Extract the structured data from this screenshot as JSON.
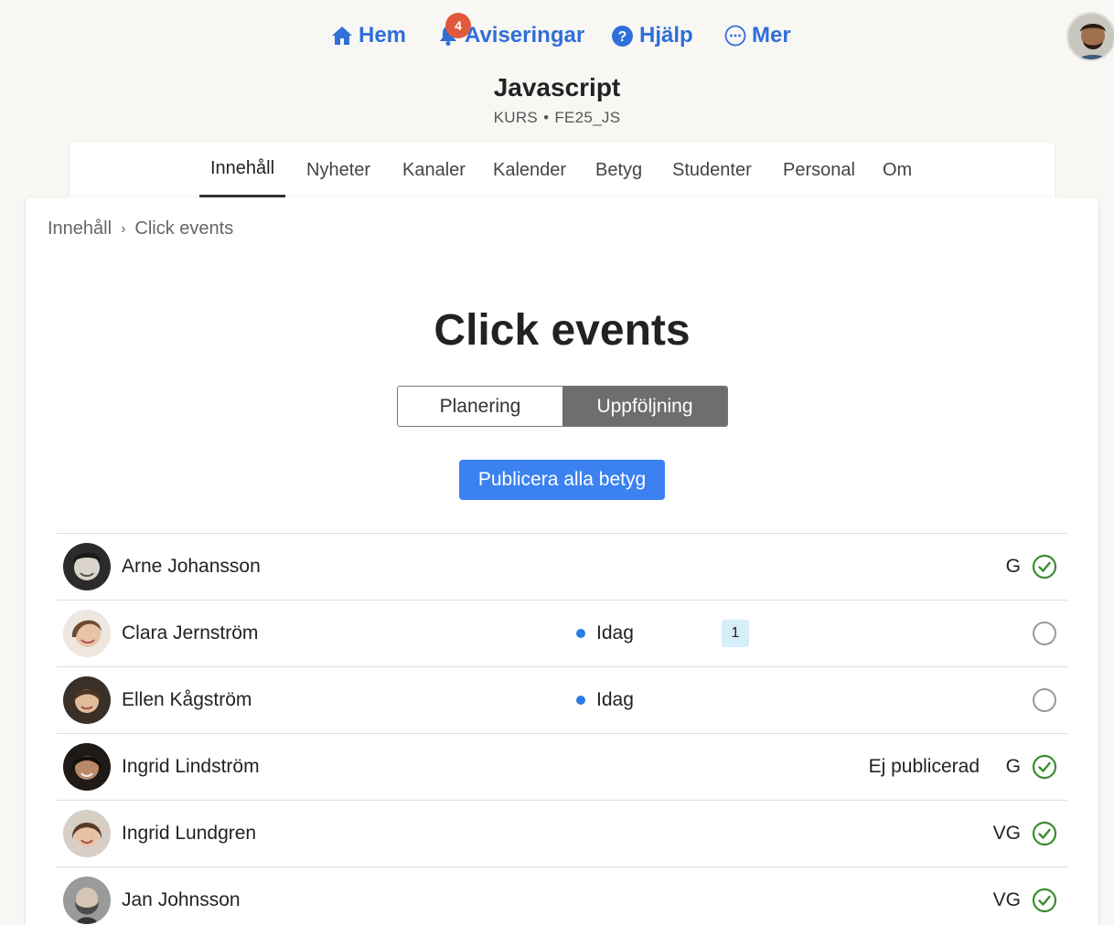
{
  "nav": {
    "home_label": "Hem",
    "notifications_label": "Aviseringar",
    "notifications_count": "4",
    "help_label": "Hjälp",
    "more_label": "Mer"
  },
  "course": {
    "title": "Javascript",
    "type": "KURS",
    "code": "FE25_JS"
  },
  "tabs": [
    {
      "label": "Innehåll",
      "active": true
    },
    {
      "label": "Nyheter"
    },
    {
      "label": "Kanaler"
    },
    {
      "label": "Kalender"
    },
    {
      "label": "Betyg"
    },
    {
      "label": "Studenter"
    },
    {
      "label": "Personal"
    },
    {
      "label": "Om"
    }
  ],
  "breadcrumb": {
    "root": "Innehåll",
    "current": "Click events"
  },
  "page": {
    "title": "Click events",
    "seg_planning": "Planering",
    "seg_followup": "Uppföljning",
    "publish_label": "Publicera alla betyg"
  },
  "students": [
    {
      "name": "Arne Johansson",
      "status": "",
      "count": "",
      "note": "",
      "grade": "G",
      "done": true
    },
    {
      "name": "Clara Jernström",
      "status": "Idag",
      "count": "1",
      "note": "",
      "grade": "",
      "done": false
    },
    {
      "name": "Ellen Kågström",
      "status": "Idag",
      "count": "",
      "note": "",
      "grade": "",
      "done": false
    },
    {
      "name": "Ingrid Lindström",
      "status": "",
      "count": "",
      "note": "Ej publicerad",
      "grade": "G",
      "done": true
    },
    {
      "name": "Ingrid Lundgren",
      "status": "",
      "count": "",
      "note": "",
      "grade": "VG",
      "done": true
    },
    {
      "name": "Jan Johnsson",
      "status": "",
      "count": "",
      "note": "",
      "grade": "VG",
      "done": true
    }
  ],
  "colors": {
    "accent": "#2f6fd8",
    "primary_button": "#3b82f0",
    "badge": "#e0593e",
    "check_green": "#3a8d2f",
    "status_dot": "#2d7be5"
  }
}
